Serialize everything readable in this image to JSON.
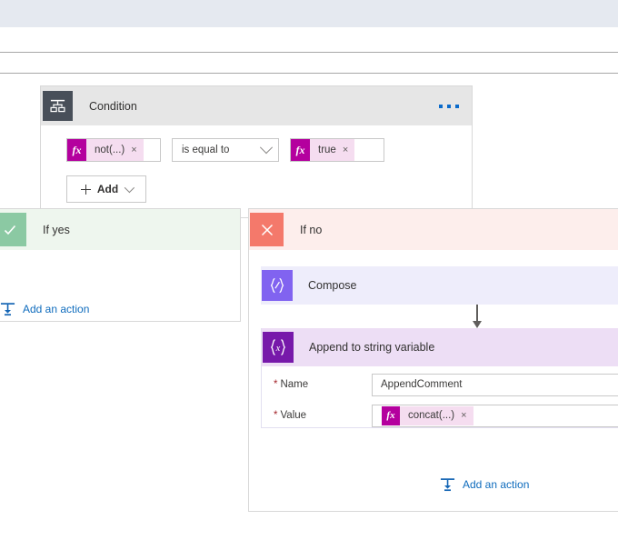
{
  "window": {
    "top_band_color": "#e5e9f0"
  },
  "condition": {
    "title": "Condition",
    "icon": "condition-branch-icon",
    "menu_icon": "ellipsis-menu-icon",
    "left_operand": {
      "fx_label": "fx",
      "token": "not(...)",
      "remove": "×"
    },
    "operator": {
      "value": "is equal to",
      "chevron": "chevron-down-icon"
    },
    "right_operand": {
      "fx_label": "fx",
      "token": "true",
      "remove": "×"
    },
    "add_button": {
      "label": "Add",
      "plus": "plus-icon",
      "chevron": "chevron-down-icon"
    }
  },
  "branches": {
    "yes": {
      "label": "If yes",
      "badge_icon": "checkmark-icon",
      "badge_color": "#8bc9a3",
      "header_bg": "#eef6ee",
      "add_action_label": "Add an action"
    },
    "no": {
      "label": "If no",
      "badge_icon": "close-x-icon",
      "badge_color": "#f4796b",
      "header_bg": "#fdeeec",
      "add_action_label": "Add an action"
    }
  },
  "actions": [
    {
      "title": "Compose",
      "icon": "compose-braces-icon",
      "icon_glyph": "{∕}",
      "icon_color": "#8163f0",
      "header_bg": "#eeedfb"
    },
    {
      "title": "Append to string variable",
      "icon": "variable-braces-x-icon",
      "icon_glyph": "{x}",
      "icon_color": "#7719aa",
      "header_bg": "#eddef5",
      "fields": [
        {
          "label": "Name",
          "required": "*",
          "value": "AppendComment",
          "type": "text"
        },
        {
          "label": "Value",
          "required": "*",
          "fx_label": "fx",
          "token": "concat(...)",
          "remove": "×",
          "type": "token"
        }
      ]
    }
  ],
  "colors": {
    "fx_badge": "#b4009e",
    "token_pill": "#f5ddf0",
    "link": "#0f6cbd",
    "required": "#a4262c"
  }
}
